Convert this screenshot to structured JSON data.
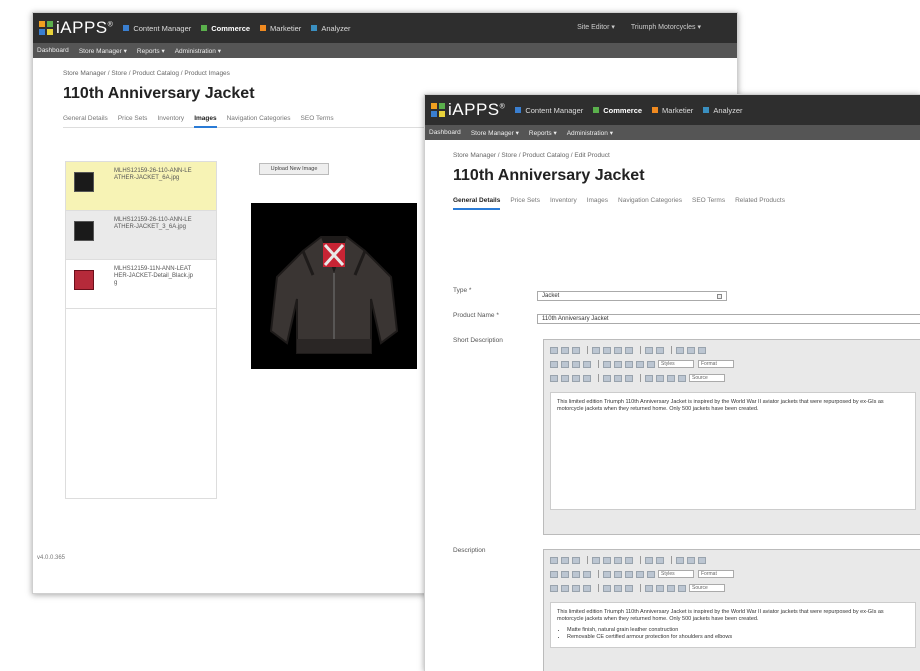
{
  "brand": {
    "name": "iAPPS",
    "mark": "®",
    "colors": [
      "#f0a020",
      "#5ab04c",
      "#3a7fd0",
      "#e8d23a"
    ]
  },
  "modules": [
    {
      "label": "Content Manager",
      "color": "#3a7fd0",
      "active": false
    },
    {
      "label": "Commerce",
      "color": "#5ab04c",
      "active": true
    },
    {
      "label": "Marketier",
      "color": "#f08a20",
      "active": false
    },
    {
      "label": "Analyzer",
      "color": "#3a8fc0",
      "active": false
    }
  ],
  "site_menu": {
    "site_editor": "Site Editor ▾",
    "site": "Triumph Motorcycles ▾"
  },
  "subnav": [
    "Dashboard",
    "Store Manager ▾",
    "Reports ▾",
    "Administration ▾"
  ],
  "back_window": {
    "breadcrumb": "Store Manager / Store / Product Catalog / Product Images",
    "title": "110th Anniversary Jacket",
    "tabs": [
      "General Details",
      "Price Sets",
      "Inventory",
      "Images",
      "Navigation Categories",
      "SEO Terms"
    ],
    "active_tab": "Images",
    "upload_label": "Upload New Image",
    "images": [
      {
        "filename": "MLHS12159-26-110-ANN-LEATHER-JACKET_6A.jpg",
        "thumb": "dark"
      },
      {
        "filename": "MLHS12159-26-110-ANN-LEATHER-JACKET_3_6A.jpg",
        "thumb": "dark"
      },
      {
        "filename": "MLHS12159-11N-ANN-LEATHER-JACKET-Detail_Black.jpg",
        "thumb": "red"
      }
    ],
    "version": "v4.0.0.365"
  },
  "front_window": {
    "breadcrumb": "Store Manager / Store / Product Catalog / Edit Product",
    "title": "110th Anniversary Jacket",
    "tabs": [
      "General Details",
      "Price Sets",
      "Inventory",
      "Images",
      "Navigation Categories",
      "SEO Terms",
      "Related Products"
    ],
    "active_tab": "General Details",
    "fields": {
      "type_label": "Type *",
      "type_value": "Jacket",
      "name_label": "Product Name *",
      "name_value": "110th Anniversary Jacket",
      "short_label": "Short Description",
      "desc_label": "Description"
    },
    "toolbar": {
      "style": "Styles",
      "format": "Format",
      "source": "Source"
    },
    "short_description": "This limited edition Triumph 110th Anniversary Jacket is inspired by the World War II aviator jackets that were repurposed by ex-GIs as motorcycle jackets when they returned home. Only 500 jackets have been created.",
    "description": "This limited edition Triumph 110th Anniversary Jacket is inspired by the World War II aviator jackets that were repurposed by ex-GIs as motorcycle jackets when they returned home. Only 500 jackets have been created.",
    "bullets": [
      "Matte finish, natural grain leather construction",
      "Removable CE certified armour protection for shoulders and elbows"
    ]
  }
}
